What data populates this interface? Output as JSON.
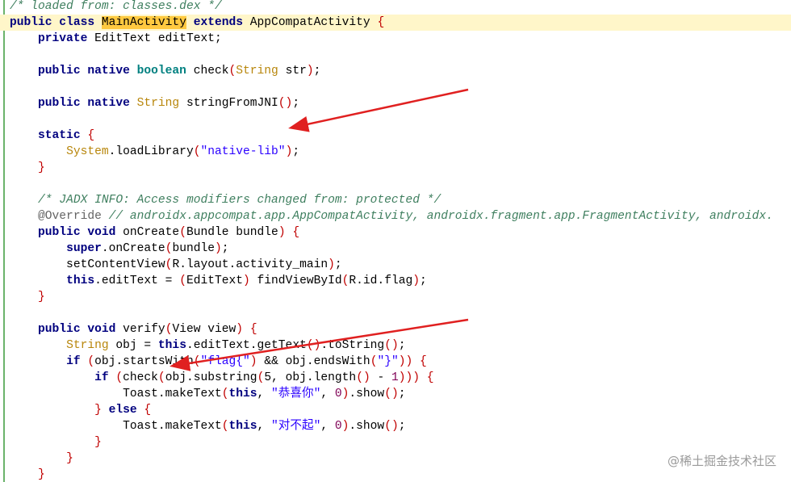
{
  "lines": [
    {
      "segments": [
        {
          "t": "/* loaded from: classes.dex */",
          "c": "cmt"
        }
      ]
    },
    {
      "highlight": true,
      "segments": [
        {
          "t": "public class ",
          "c": "kw"
        },
        {
          "t": "MainActivity",
          "c": "cls-highlight"
        },
        {
          "t": " ",
          "c": ""
        },
        {
          "t": "extends",
          "c": "kw"
        },
        {
          "t": " AppCompatActivity ",
          "c": ""
        },
        {
          "t": "{",
          "c": "paren"
        }
      ]
    },
    {
      "segments": [
        {
          "t": "    ",
          "c": ""
        },
        {
          "t": "private",
          "c": "kw"
        },
        {
          "t": " EditText editText;",
          "c": ""
        }
      ]
    },
    {
      "segments": []
    },
    {
      "segments": [
        {
          "t": "    ",
          "c": ""
        },
        {
          "t": "public native ",
          "c": "kw"
        },
        {
          "t": "boolean",
          "c": "prim"
        },
        {
          "t": " check",
          "c": ""
        },
        {
          "t": "(",
          "c": "paren"
        },
        {
          "t": "String",
          "c": "typ"
        },
        {
          "t": " str",
          "c": ""
        },
        {
          "t": ")",
          "c": "paren"
        },
        {
          "t": ";",
          "c": ""
        }
      ]
    },
    {
      "segments": []
    },
    {
      "segments": [
        {
          "t": "    ",
          "c": ""
        },
        {
          "t": "public native ",
          "c": "kw"
        },
        {
          "t": "String",
          "c": "typ"
        },
        {
          "t": " stringFromJNI",
          "c": ""
        },
        {
          "t": "()",
          "c": "paren"
        },
        {
          "t": ";",
          "c": ""
        }
      ]
    },
    {
      "segments": []
    },
    {
      "segments": [
        {
          "t": "    ",
          "c": ""
        },
        {
          "t": "static",
          "c": "kw"
        },
        {
          "t": " ",
          "c": ""
        },
        {
          "t": "{",
          "c": "paren"
        }
      ]
    },
    {
      "segments": [
        {
          "t": "        ",
          "c": ""
        },
        {
          "t": "System",
          "c": "typ"
        },
        {
          "t": ".loadLibrary",
          "c": ""
        },
        {
          "t": "(",
          "c": "paren"
        },
        {
          "t": "\"native-lib\"",
          "c": "str"
        },
        {
          "t": ")",
          "c": "paren"
        },
        {
          "t": ";",
          "c": ""
        }
      ]
    },
    {
      "segments": [
        {
          "t": "    ",
          "c": ""
        },
        {
          "t": "}",
          "c": "paren"
        }
      ]
    },
    {
      "segments": []
    },
    {
      "segments": [
        {
          "t": "    ",
          "c": ""
        },
        {
          "t": "/* JADX INFO: Access modifiers changed from: protected */",
          "c": "cmt"
        }
      ]
    },
    {
      "segments": [
        {
          "t": "    ",
          "c": ""
        },
        {
          "t": "@Override",
          "c": "ann"
        },
        {
          "t": " ",
          "c": ""
        },
        {
          "t": "// androidx.appcompat.app.AppCompatActivity, androidx.fragment.app.FragmentActivity, androidx.",
          "c": "cmt"
        }
      ]
    },
    {
      "segments": [
        {
          "t": "    ",
          "c": ""
        },
        {
          "t": "public void",
          "c": "kw"
        },
        {
          "t": " onCreate",
          "c": ""
        },
        {
          "t": "(",
          "c": "paren"
        },
        {
          "t": "Bundle bundle",
          "c": ""
        },
        {
          "t": ")",
          "c": "paren"
        },
        {
          "t": " ",
          "c": ""
        },
        {
          "t": "{",
          "c": "paren"
        }
      ]
    },
    {
      "segments": [
        {
          "t": "        ",
          "c": ""
        },
        {
          "t": "super",
          "c": "kw"
        },
        {
          "t": ".onCreate",
          "c": ""
        },
        {
          "t": "(",
          "c": "paren"
        },
        {
          "t": "bundle",
          "c": ""
        },
        {
          "t": ")",
          "c": "paren"
        },
        {
          "t": ";",
          "c": ""
        }
      ]
    },
    {
      "segments": [
        {
          "t": "        setContentView",
          "c": ""
        },
        {
          "t": "(",
          "c": "paren"
        },
        {
          "t": "R.layout.activity_main",
          "c": ""
        },
        {
          "t": ")",
          "c": "paren"
        },
        {
          "t": ";",
          "c": ""
        }
      ]
    },
    {
      "segments": [
        {
          "t": "        ",
          "c": ""
        },
        {
          "t": "this",
          "c": "kw"
        },
        {
          "t": ".editText = ",
          "c": ""
        },
        {
          "t": "(",
          "c": "paren"
        },
        {
          "t": "EditText",
          "c": ""
        },
        {
          "t": ")",
          "c": "paren"
        },
        {
          "t": " findViewById",
          "c": ""
        },
        {
          "t": "(",
          "c": "paren"
        },
        {
          "t": "R.id.flag",
          "c": ""
        },
        {
          "t": ")",
          "c": "paren"
        },
        {
          "t": ";",
          "c": ""
        }
      ]
    },
    {
      "segments": [
        {
          "t": "    ",
          "c": ""
        },
        {
          "t": "}",
          "c": "paren"
        }
      ]
    },
    {
      "segments": []
    },
    {
      "segments": [
        {
          "t": "    ",
          "c": ""
        },
        {
          "t": "public void",
          "c": "kw"
        },
        {
          "t": " verify",
          "c": ""
        },
        {
          "t": "(",
          "c": "paren"
        },
        {
          "t": "View view",
          "c": ""
        },
        {
          "t": ")",
          "c": "paren"
        },
        {
          "t": " ",
          "c": ""
        },
        {
          "t": "{",
          "c": "paren"
        }
      ]
    },
    {
      "segments": [
        {
          "t": "        ",
          "c": ""
        },
        {
          "t": "String",
          "c": "typ"
        },
        {
          "t": " obj = ",
          "c": ""
        },
        {
          "t": "this",
          "c": "kw"
        },
        {
          "t": ".editText.getText",
          "c": ""
        },
        {
          "t": "()",
          "c": "paren"
        },
        {
          "t": ".toString",
          "c": ""
        },
        {
          "t": "()",
          "c": "paren"
        },
        {
          "t": ";",
          "c": ""
        }
      ]
    },
    {
      "segments": [
        {
          "t": "        ",
          "c": ""
        },
        {
          "t": "if",
          "c": "kw"
        },
        {
          "t": " ",
          "c": ""
        },
        {
          "t": "(",
          "c": "paren"
        },
        {
          "t": "obj.startsWith",
          "c": ""
        },
        {
          "t": "(",
          "c": "paren"
        },
        {
          "t": "\"flag{\"",
          "c": "str"
        },
        {
          "t": ")",
          "c": "paren"
        },
        {
          "t": " && obj.endsWith",
          "c": ""
        },
        {
          "t": "(",
          "c": "paren"
        },
        {
          "t": "\"}\"",
          "c": "str"
        },
        {
          "t": "))",
          "c": "paren"
        },
        {
          "t": " ",
          "c": ""
        },
        {
          "t": "{",
          "c": "paren"
        }
      ]
    },
    {
      "segments": [
        {
          "t": "            ",
          "c": ""
        },
        {
          "t": "if",
          "c": "kw"
        },
        {
          "t": " ",
          "c": ""
        },
        {
          "t": "(",
          "c": "paren"
        },
        {
          "t": "check",
          "c": ""
        },
        {
          "t": "(",
          "c": "paren"
        },
        {
          "t": "obj.substring",
          "c": ""
        },
        {
          "t": "(",
          "c": "paren"
        },
        {
          "t": "5, obj.length",
          "c": ""
        },
        {
          "t": "()",
          "c": "paren"
        },
        {
          "t": " - ",
          "c": ""
        },
        {
          "t": "1",
          "c": "num"
        },
        {
          "t": ")))",
          "c": "paren"
        },
        {
          "t": " ",
          "c": ""
        },
        {
          "t": "{",
          "c": "paren"
        }
      ]
    },
    {
      "segments": [
        {
          "t": "                Toast.makeText",
          "c": ""
        },
        {
          "t": "(",
          "c": "paren"
        },
        {
          "t": "this",
          "c": "kw"
        },
        {
          "t": ", ",
          "c": ""
        },
        {
          "t": "\"恭喜你\"",
          "c": "str"
        },
        {
          "t": ", ",
          "c": ""
        },
        {
          "t": "0",
          "c": "num"
        },
        {
          "t": ")",
          "c": "paren"
        },
        {
          "t": ".show",
          "c": ""
        },
        {
          "t": "()",
          "c": "paren"
        },
        {
          "t": ";",
          "c": ""
        }
      ]
    },
    {
      "segments": [
        {
          "t": "            ",
          "c": ""
        },
        {
          "t": "}",
          "c": "paren"
        },
        {
          "t": " ",
          "c": ""
        },
        {
          "t": "else",
          "c": "kw"
        },
        {
          "t": " ",
          "c": ""
        },
        {
          "t": "{",
          "c": "paren"
        }
      ]
    },
    {
      "segments": [
        {
          "t": "                Toast.makeText",
          "c": ""
        },
        {
          "t": "(",
          "c": "paren"
        },
        {
          "t": "this",
          "c": "kw"
        },
        {
          "t": ", ",
          "c": ""
        },
        {
          "t": "\"对不起\"",
          "c": "str"
        },
        {
          "t": ", ",
          "c": ""
        },
        {
          "t": "0",
          "c": "num"
        },
        {
          "t": ")",
          "c": "paren"
        },
        {
          "t": ".show",
          "c": ""
        },
        {
          "t": "()",
          "c": "paren"
        },
        {
          "t": ";",
          "c": ""
        }
      ]
    },
    {
      "segments": [
        {
          "t": "            ",
          "c": ""
        },
        {
          "t": "}",
          "c": "paren"
        }
      ]
    },
    {
      "segments": [
        {
          "t": "        ",
          "c": ""
        },
        {
          "t": "}",
          "c": "paren"
        }
      ]
    },
    {
      "segments": [
        {
          "t": "    ",
          "c": ""
        },
        {
          "t": "}",
          "c": "paren"
        }
      ]
    }
  ],
  "watermark": "@稀土掘金技术社区",
  "annotations": {
    "arrow_color": "#e02020",
    "arrow_1_target": "static block",
    "arrow_2_target": "flag{ prefix check"
  }
}
